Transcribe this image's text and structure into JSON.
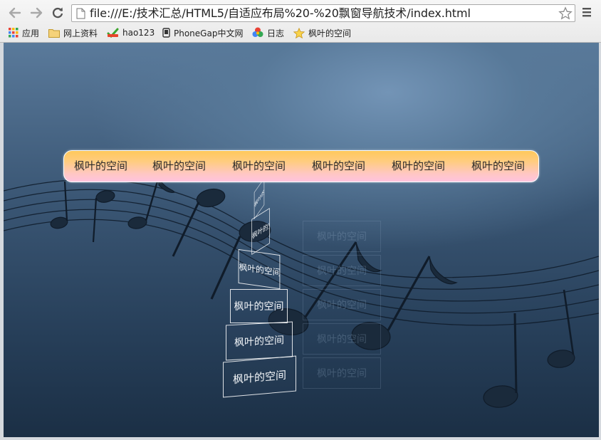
{
  "browser": {
    "url": "file:///E:/技术汇总/HTML5/自适应布局%20-%20飘窗导航技术/index.html",
    "bookmarks": [
      {
        "label": "应用",
        "icon": "apps-grid-icon"
      },
      {
        "label": "网上资料",
        "icon": "folder-icon"
      },
      {
        "label": "hao123",
        "icon": "hao123-icon"
      },
      {
        "label": "PhoneGap中文网",
        "icon": "phone-icon"
      },
      {
        "label": "日志",
        "icon": "colorful-circles-icon"
      },
      {
        "label": "枫叶的空间",
        "icon": "star-icon"
      }
    ]
  },
  "nav": {
    "items": [
      "枫叶的空间",
      "枫叶的空间",
      "枫叶的空间",
      "枫叶的空间",
      "枫叶的空间",
      "枫叶的空间"
    ]
  },
  "dropdown": {
    "items": [
      "枫叶的空间",
      "枫叶的空间",
      "枫叶的空间",
      "枫叶的空间",
      "枫叶的空间",
      "枫叶的空间"
    ]
  },
  "ghost": {
    "items": [
      "枫叶的空间",
      "枫叶的空间",
      "枫叶的空间",
      "枫叶的空间",
      "枫叶的空间"
    ]
  },
  "colors": {
    "nav_top": "#ffc85c",
    "nav_bottom": "#ffc3de",
    "background_dark": "#1b2f45",
    "background_light": "#7394b6"
  }
}
